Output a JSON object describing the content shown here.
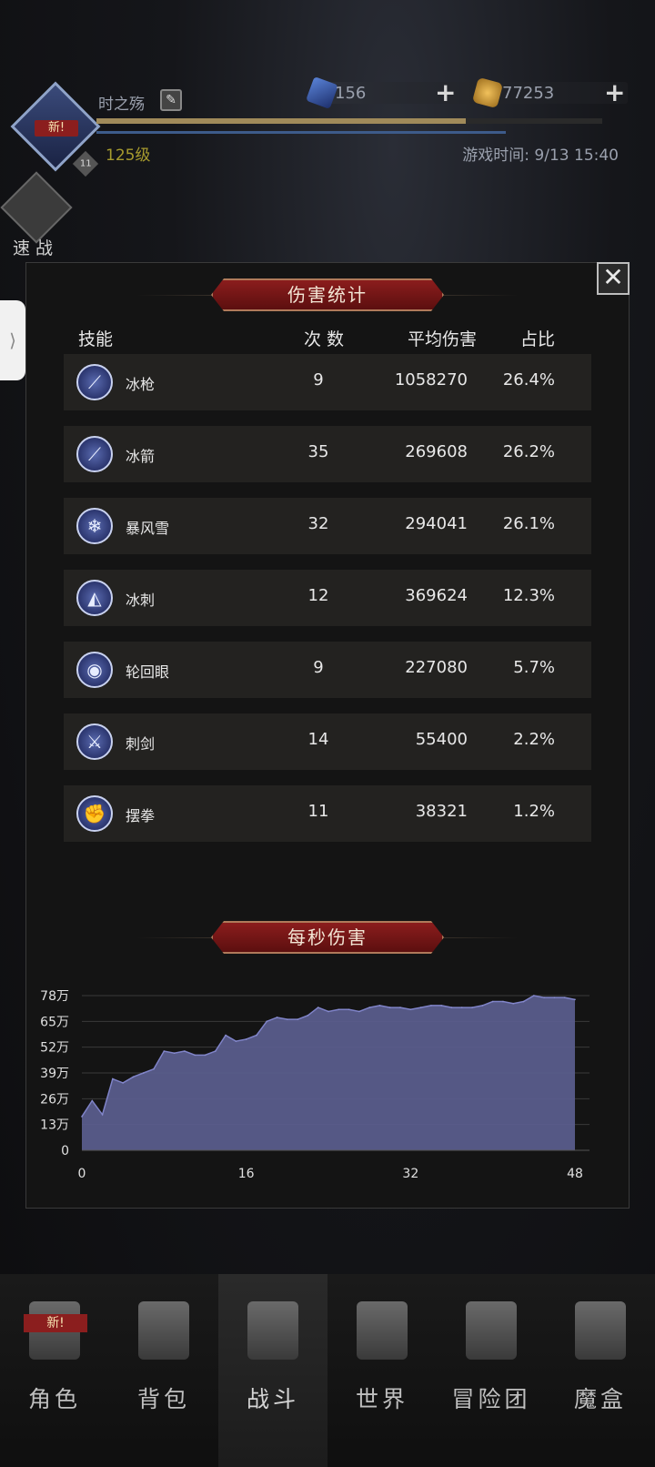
{
  "hud": {
    "player_name": "时之殇",
    "new_badge": "新!",
    "level": "125级",
    "level_badge": "11",
    "gems": "156",
    "gold": "77253",
    "game_time": "游戏时间: 9/13 15:40",
    "quick_battle": "速战",
    "side_tab_arrow": "⟩"
  },
  "panel": {
    "close_label": "✕",
    "title": "伤害统计",
    "columns": {
      "skill": "技能",
      "count": "次 数",
      "avg": "平均伤害",
      "pct": "占比"
    },
    "skills": [
      {
        "icon": "ice-spear-icon",
        "glyph": "⟋",
        "name": "冰枪",
        "count": "9",
        "avg": "1058270",
        "pct": "26.4%"
      },
      {
        "icon": "ice-arrow-icon",
        "glyph": "⟋",
        "name": "冰箭",
        "count": "35",
        "avg": "269608",
        "pct": "26.2%"
      },
      {
        "icon": "blizzard-icon",
        "glyph": "❄",
        "name": "暴风雪",
        "count": "32",
        "avg": "294041",
        "pct": "26.1%"
      },
      {
        "icon": "ice-spike-icon",
        "glyph": "◭",
        "name": "冰刺",
        "count": "12",
        "avg": "369624",
        "pct": "12.3%"
      },
      {
        "icon": "samsara-eye-icon",
        "glyph": "◉",
        "name": "轮回眼",
        "count": "9",
        "avg": "227080",
        "pct": "5.7%"
      },
      {
        "icon": "stab-sword-icon",
        "glyph": "⚔",
        "name": "刺剑",
        "count": "14",
        "avg": "55400",
        "pct": "2.2%"
      },
      {
        "icon": "swing-fist-icon",
        "glyph": "✊",
        "name": "摆拳",
        "count": "11",
        "avg": "38321",
        "pct": "1.2%"
      }
    ],
    "dps_title": "每秒伤害"
  },
  "chart_data": {
    "type": "area",
    "title": "每秒伤害",
    "xlabel": "",
    "ylabel": "",
    "xlim": [
      0,
      48
    ],
    "ylim": [
      0,
      78
    ],
    "x_ticks": [
      "0",
      "16",
      "32",
      "48"
    ],
    "y_ticks": [
      "0",
      "13万",
      "26万",
      "39万",
      "52万",
      "65万",
      "78万"
    ],
    "grid": true,
    "color": "#5c5f91",
    "x": [
      0,
      1,
      2,
      3,
      4,
      5,
      6,
      7,
      8,
      9,
      10,
      11,
      12,
      13,
      14,
      15,
      16,
      17,
      18,
      19,
      20,
      21,
      22,
      23,
      24,
      25,
      26,
      27,
      28,
      29,
      30,
      31,
      32,
      33,
      34,
      35,
      36,
      37,
      38,
      39,
      40,
      41,
      42,
      43,
      44,
      45,
      46,
      47,
      48
    ],
    "values": [
      17,
      25,
      18,
      36,
      34,
      37,
      39,
      41,
      50,
      49,
      50,
      48,
      48,
      50,
      58,
      55,
      56,
      58,
      65,
      67,
      66,
      66,
      68,
      72,
      70,
      71,
      71,
      70,
      72,
      73,
      72,
      72,
      71,
      72,
      73,
      73,
      72,
      72,
      72,
      73,
      75,
      75,
      74,
      75,
      78,
      77,
      77,
      77,
      76
    ]
  },
  "nav": [
    {
      "label": "角色",
      "icon": "helmet-icon",
      "active": false,
      "new": "新!"
    },
    {
      "label": "背包",
      "icon": "backpack-icon",
      "active": false
    },
    {
      "label": "战斗",
      "icon": "shield-sword-icon",
      "active": true
    },
    {
      "label": "世界",
      "icon": "map-icon",
      "active": false
    },
    {
      "label": "冒险团",
      "icon": "castle-icon",
      "active": false
    },
    {
      "label": "魔盒",
      "icon": "magic-cube-icon",
      "active": false
    }
  ]
}
